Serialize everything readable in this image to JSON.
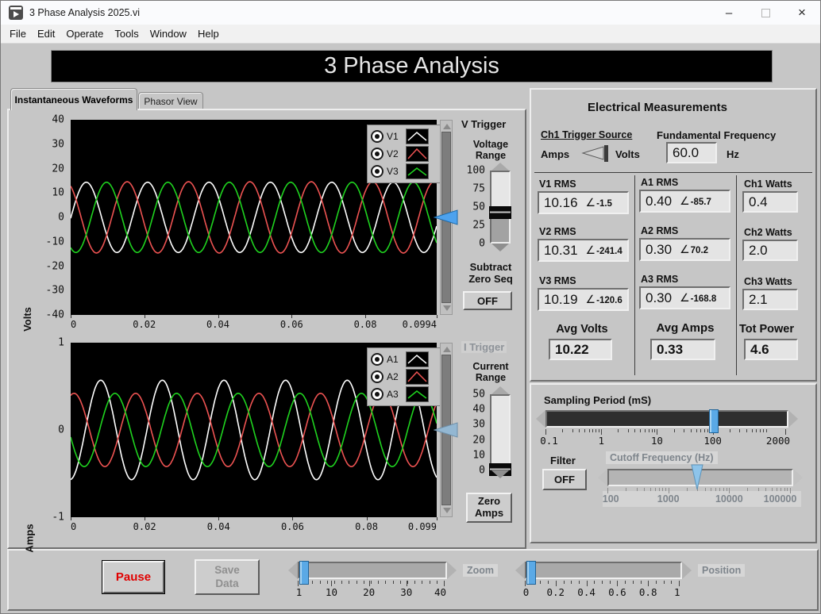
{
  "window": {
    "title": "3 Phase Analysis 2025.vi",
    "minimize": "–",
    "close": "×"
  },
  "menu": {
    "items": [
      "File",
      "Edit",
      "Operate",
      "Tools",
      "Window",
      "Help"
    ]
  },
  "banner": {
    "title": "3 Phase Analysis"
  },
  "tabs": [
    {
      "label": "Instantaneous Waveforms"
    },
    {
      "label": "Phasor View"
    }
  ],
  "charts": {
    "volts": {
      "type": "line",
      "ylabel": "Volts",
      "ylim": [
        -40,
        40
      ],
      "yticks": [
        40,
        30,
        20,
        10,
        0,
        -10,
        -20,
        -30,
        -40
      ],
      "xticks": [
        0,
        0.02,
        0.04,
        0.06,
        0.08,
        0.0994
      ],
      "xtick_labels": [
        "0",
        "0.02",
        "0.04",
        "0.06",
        "0.08",
        "0.0994"
      ],
      "t_max": 0.0994,
      "frequency_hz": 60,
      "legend": [
        {
          "label": "V1"
        },
        {
          "label": "V2"
        },
        {
          "label": "V3"
        }
      ],
      "series": [
        {
          "name": "V1",
          "color": "#ffffff",
          "amplitude": 14.4,
          "phase_deg": -1.5
        },
        {
          "name": "V2",
          "color": "#ee5352",
          "amplitude": 14.6,
          "phase_deg": -241.4
        },
        {
          "name": "V3",
          "color": "#1fd41f",
          "amplitude": 14.4,
          "phase_deg": -120.6
        }
      ]
    },
    "amps": {
      "type": "line",
      "ylabel": "Amps",
      "ylim": [
        -1,
        1
      ],
      "yticks": [
        1,
        0,
        -1
      ],
      "xticks": [
        0,
        0.02,
        0.04,
        0.06,
        0.08,
        0.099
      ],
      "xtick_labels": [
        "0",
        "0.02",
        "0.04",
        "0.06",
        "0.08",
        "0.099"
      ],
      "t_max": 0.099,
      "frequency_hz": 60,
      "legend": [
        {
          "label": "A1"
        },
        {
          "label": "A2"
        },
        {
          "label": "A3"
        }
      ],
      "series": [
        {
          "name": "A1",
          "color": "#ffffff",
          "amplitude": 0.57,
          "phase_deg": -85.7
        },
        {
          "name": "A2",
          "color": "#ee5352",
          "amplitude": 0.42,
          "phase_deg": 70.2
        },
        {
          "name": "A3",
          "color": "#1fd41f",
          "amplitude": 0.42,
          "phase_deg": -168.8
        }
      ]
    }
  },
  "v_trigger": {
    "title": "V Trigger",
    "range_label": "Voltage Range",
    "slider": {
      "min": 0,
      "max": 100,
      "value": 43,
      "tick_labels": [
        100,
        75,
        50,
        25,
        0
      ]
    },
    "subtract_label": "Subtract Zero Seq",
    "button_label": "OFF"
  },
  "i_trigger": {
    "title": "I Trigger",
    "range_label": "Current Range",
    "slider": {
      "min": 0,
      "max": 50,
      "value": 0,
      "tick_labels": [
        50,
        40,
        30,
        20,
        10,
        0
      ]
    },
    "button_label": "Zero Amps"
  },
  "measurements": {
    "title": "Electrical Measurements",
    "trigger_source": {
      "label": "Ch1 Trigger Source",
      "left": "Amps",
      "right": "Volts"
    },
    "fundamental": {
      "label": "Fundamental Frequency",
      "value": "60.0",
      "unit": "Hz"
    },
    "voltage": [
      {
        "label": "V1 RMS",
        "value": "10.16",
        "angle": "-1.5"
      },
      {
        "label": "V2 RMS",
        "value": "10.31",
        "angle": "-241.4"
      },
      {
        "label": "V3 RMS",
        "value": "10.19",
        "angle": "-120.6"
      }
    ],
    "current": [
      {
        "label": "A1 RMS",
        "value": "0.40",
        "angle": "-85.7"
      },
      {
        "label": "A2 RMS",
        "value": "0.30",
        "angle": "70.2"
      },
      {
        "label": "A3 RMS",
        "value": "0.30",
        "angle": "-168.8"
      }
    ],
    "watts": [
      {
        "label": "Ch1 Watts",
        "value": "0.4"
      },
      {
        "label": "Ch2 Watts",
        "value": "2.0"
      },
      {
        "label": "Ch3 Watts",
        "value": "2.1"
      }
    ],
    "averages": [
      {
        "label": "Avg Volts",
        "value": "10.22"
      },
      {
        "label": "Avg Amps",
        "value": "0.33"
      },
      {
        "label": "Tot Power",
        "value": "4.6"
      }
    ]
  },
  "sampling": {
    "label": "Sampling Period (mS)",
    "slider": {
      "scale": "log",
      "min": 0.1,
      "max": 2000,
      "value": 100,
      "tick_labels": [
        0.1,
        1,
        10,
        100,
        2000
      ]
    }
  },
  "filter": {
    "label": "Filter",
    "button_label": "OFF",
    "cutoff_label": "Cutoff Frequency (Hz)",
    "slider": {
      "scale": "log",
      "min": 100,
      "max": 100000,
      "value": 3000,
      "tick_labels": [
        100,
        1000,
        10000,
        100000
      ]
    }
  },
  "transport": {
    "pause_label": "Pause",
    "save_label": "Save\nData",
    "zoom_label": "Zoom",
    "zoom_slider": {
      "scale": "linear",
      "min": 1,
      "max": 40,
      "value": 1,
      "tick_labels": [
        1,
        10,
        20,
        30,
        40
      ]
    },
    "position_label": "Position",
    "position_slider": {
      "scale": "linear",
      "min": 0,
      "max": 1,
      "value": 0,
      "tick_labels": [
        0,
        0.2,
        0.4,
        0.6,
        0.8,
        1
      ]
    }
  }
}
